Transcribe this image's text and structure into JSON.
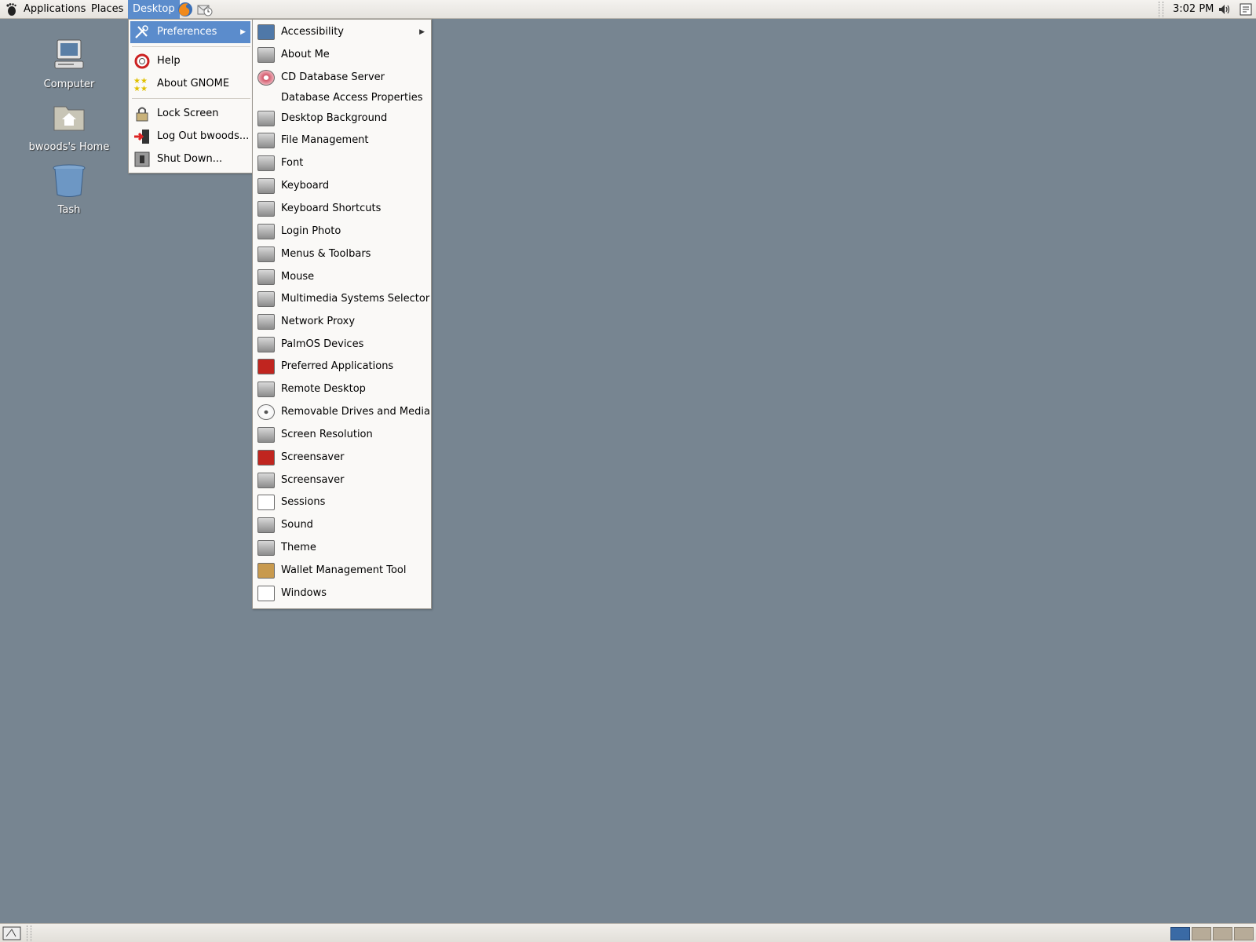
{
  "top_panel": {
    "menus": {
      "applications": "Applications",
      "places": "Places",
      "desktop": "Desktop"
    },
    "launchers": [
      "firefox-icon",
      "evolution-icon"
    ],
    "clock": "3:02 PM",
    "tray_icons": [
      "volume-icon",
      "notes-icon"
    ]
  },
  "desktop_icons": {
    "computer": "Computer",
    "home": "bwoods's Home",
    "trash": "Tash"
  },
  "desktop_menu": {
    "preferences": "Preferences",
    "help": "Help",
    "about_gnome": "About GNOME",
    "lock_screen": "Lock Screen",
    "log_out": "Log Out bwoods...",
    "shut_down": "Shut Down..."
  },
  "preferences_menu": {
    "items": [
      {
        "label": "Accessibility",
        "icon": "accessibility-icon",
        "submenu": true
      },
      {
        "label": "About Me",
        "icon": "about-me-icon"
      },
      {
        "label": "CD Database Server",
        "icon": "cd-database-icon"
      },
      {
        "label": "Database Access Properties",
        "icon": ""
      },
      {
        "label": "Desktop Background",
        "icon": "desktop-background-icon"
      },
      {
        "label": "File Management",
        "icon": "file-management-icon"
      },
      {
        "label": "Font",
        "icon": "font-icon"
      },
      {
        "label": "Keyboard",
        "icon": "keyboard-icon"
      },
      {
        "label": "Keyboard Shortcuts",
        "icon": "keyboard-shortcuts-icon"
      },
      {
        "label": "Login Photo",
        "icon": "login-photo-icon"
      },
      {
        "label": "Menus & Toolbars",
        "icon": "menus-toolbars-icon"
      },
      {
        "label": "Mouse",
        "icon": "mouse-icon"
      },
      {
        "label": "Multimedia Systems Selector",
        "icon": "multimedia-icon"
      },
      {
        "label": "Network Proxy",
        "icon": "network-proxy-icon"
      },
      {
        "label": "PalmOS Devices",
        "icon": "palmos-icon"
      },
      {
        "label": "Preferred Applications",
        "icon": "preferred-apps-icon"
      },
      {
        "label": "Remote Desktop",
        "icon": "remote-desktop-icon"
      },
      {
        "label": "Removable Drives and Media",
        "icon": "removable-drives-icon"
      },
      {
        "label": "Screen Resolution",
        "icon": "screen-resolution-icon"
      },
      {
        "label": "Screensaver",
        "icon": "screensaver-red-icon"
      },
      {
        "label": "Screensaver",
        "icon": "screensaver-icon"
      },
      {
        "label": "Sessions",
        "icon": "sessions-icon"
      },
      {
        "label": "Sound",
        "icon": "sound-icon"
      },
      {
        "label": "Theme",
        "icon": "theme-icon"
      },
      {
        "label": "Wallet Management Tool",
        "icon": "wallet-icon"
      },
      {
        "label": "Windows",
        "icon": "windows-icon"
      }
    ]
  },
  "workspaces": {
    "count": 4,
    "active_index": 0
  },
  "colors": {
    "desktop_bg": "#778591",
    "highlight": "#5b8ccc"
  }
}
